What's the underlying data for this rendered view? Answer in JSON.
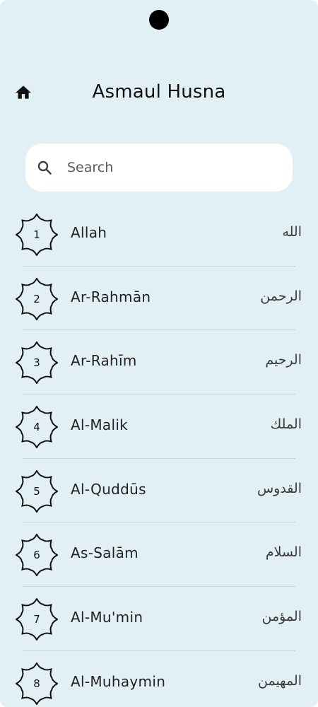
{
  "header": {
    "title": "Asmaul Husna",
    "home_icon": "home-icon"
  },
  "search": {
    "placeholder": "Search",
    "value": "",
    "icon": "search-icon"
  },
  "names": [
    {
      "number": "1",
      "latin": "Allah",
      "arabic": "الله"
    },
    {
      "number": "2",
      "latin": "Ar-Rahmān",
      "arabic": "الرحمن"
    },
    {
      "number": "3",
      "latin": "Ar-Rahīm",
      "arabic": "الرحيم"
    },
    {
      "number": "4",
      "latin": "Al-Malik",
      "arabic": "الملك"
    },
    {
      "number": "5",
      "latin": "Al-Quddūs",
      "arabic": "القدوس"
    },
    {
      "number": "6",
      "latin": "As-Salām",
      "arabic": "السلام"
    },
    {
      "number": "7",
      "latin": "Al-Mu'min",
      "arabic": "المؤمن"
    },
    {
      "number": "8",
      "latin": "Al-Muhaymin",
      "arabic": "المهيمن"
    }
  ],
  "colors": {
    "background": "#e2eff5",
    "surface": "#ffffff",
    "text": "#111111",
    "divider": "#c8d4d9"
  }
}
